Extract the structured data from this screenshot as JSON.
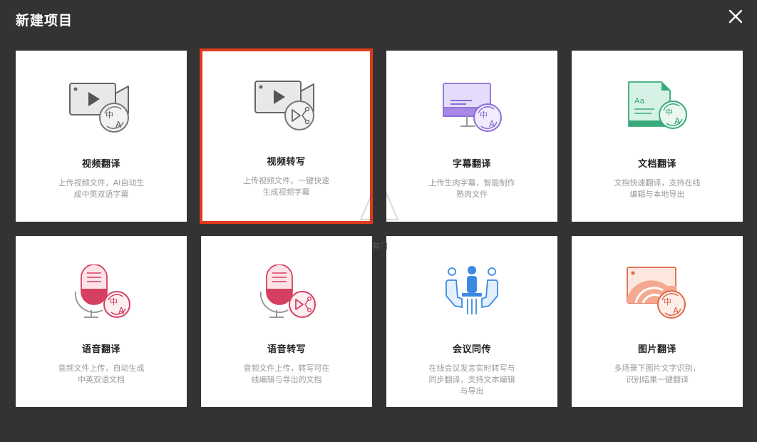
{
  "dialog": {
    "title": "新建项目"
  },
  "colors": {
    "background": "#333333",
    "card_bg": "#ffffff",
    "selected_border": "#e23a1f",
    "title_text": "#222222",
    "desc_text": "#9a9a9a"
  },
  "cards": [
    {
      "title": "视频翻译",
      "desc": "上传视频文件，AI自动生成中英双语字幕",
      "icon": "video-translate-icon",
      "selected": false
    },
    {
      "title": "视频转写",
      "desc": "上传视频文件，一键快速生成视频字幕",
      "icon": "video-transcribe-icon",
      "selected": true
    },
    {
      "title": "字幕翻译",
      "desc": "上传生肉字幕，智能制作熟肉文件",
      "icon": "subtitle-translate-icon",
      "selected": false
    },
    {
      "title": "文档翻译",
      "desc": "文档快速翻译，支持在线编辑与本地导出",
      "icon": "document-translate-icon",
      "selected": false
    },
    {
      "title": "语音翻译",
      "desc": "音频文件上传，自动生成中英双语文档",
      "icon": "audio-translate-icon",
      "selected": false
    },
    {
      "title": "语音转写",
      "desc": "音频文件上传，转写可在线编辑与导出的文档",
      "icon": "audio-transcribe-icon",
      "selected": false
    },
    {
      "title": "会议同传",
      "desc": "在线会议发言实时转写与同步翻译，支持文本编辑与导出",
      "icon": "meeting-interpret-icon",
      "selected": false
    },
    {
      "title": "图片翻译",
      "desc": "多场景下图片文字识别，识别结果一键翻译",
      "icon": "image-translate-icon",
      "selected": false
    }
  ],
  "icon_labels": {
    "zh": "中",
    "en": "A",
    "doc_sample": "Aa"
  },
  "watermark": {
    "text": "有门"
  }
}
